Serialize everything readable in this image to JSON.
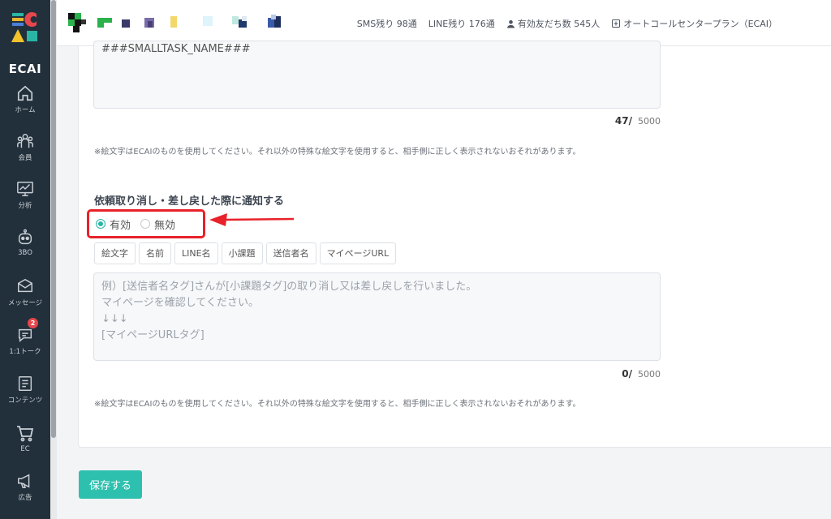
{
  "app": {
    "logo_text": "ECAI"
  },
  "sidebar": {
    "items": [
      {
        "label": "ホーム",
        "icon": "home-icon"
      },
      {
        "label": "会員",
        "icon": "members-icon"
      },
      {
        "label": "分析",
        "icon": "analytics-icon"
      },
      {
        "label": "3BO",
        "icon": "robot-icon"
      },
      {
        "label": "メッセージ",
        "icon": "message-icon"
      },
      {
        "label": "1:1トーク",
        "icon": "chat-icon",
        "badge": "2"
      },
      {
        "label": "コンテンツ",
        "icon": "content-icon"
      },
      {
        "label": "EC",
        "icon": "cart-icon"
      },
      {
        "label": "広告",
        "icon": "megaphone-icon"
      }
    ]
  },
  "header": {
    "sms": "SMS残り 98通",
    "line": "LINE残り 176通",
    "friends": "有効友だち数 545人",
    "plan": "オートコールセンタープラン（ECAI）"
  },
  "form": {
    "top_textarea_value": "###SMALLTASK_NAME###",
    "top_counter_value": "47",
    "top_counter_sep": "/",
    "top_counter_max": "5000",
    "note": "※絵文字はECAIのものを使用してください。それ以外の特殊な絵文字を使用すると、相手側に正しく表示されないおそれがあります。",
    "section_title": "依頼取り消し・差し戻した際に通知する",
    "radio_enabled": "有効",
    "radio_disabled": "無効",
    "tags": [
      "絵文字",
      "名前",
      "LINE名",
      "小課題",
      "送信者名",
      "マイページURL"
    ],
    "placeholder_lines": [
      "例）[送信者名タグ]さんが[小課題タグ]の取り消し又は差し戻しを行いました。",
      "マイページを確認してください。",
      "↓↓↓",
      "[マイページURLタグ]"
    ],
    "bottom_counter_value": "0",
    "bottom_counter_sep": "/",
    "bottom_counter_max": "5000",
    "note2": "※絵文字はECAIのものを使用してください。それ以外の特殊な絵文字を使用すると、相手側に正しく表示されないおそれがあります。"
  },
  "save_button": "保存する",
  "colors": {
    "accent": "#2ec0ae",
    "sidebar": "#22303c",
    "highlight": "#e8222a"
  }
}
